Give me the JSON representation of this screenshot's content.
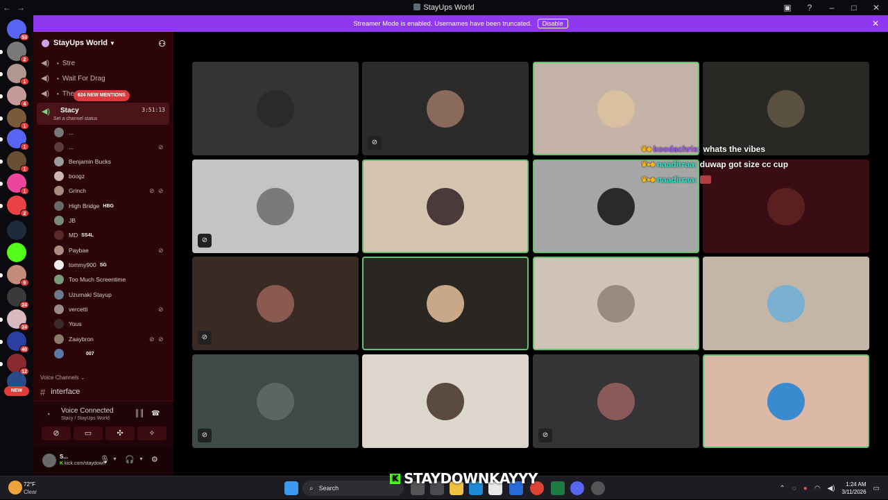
{
  "window": {
    "title": "StayUps World"
  },
  "banner": {
    "text": "Streamer Mode is enabled. Usernames have been truncated.",
    "button": "Disable"
  },
  "guild_badges": [
    "53",
    "2",
    "1",
    "4",
    "1",
    "1",
    "1",
    "1",
    "2",
    "9",
    "24",
    "24",
    "40",
    "12"
  ],
  "guild_new_label": "NEW",
  "server": {
    "name": "StayUps World"
  },
  "mentions_pill": "624 NEW MENTIONS",
  "voice_channels": [
    "Stre",
    "Wait For Drag",
    "The Bridge"
  ],
  "active_channel": {
    "name": "Stacy",
    "timer": "3:51:13",
    "status_prompt": "Set a channel status"
  },
  "members": [
    {
      "name": "...",
      "tag": ""
    },
    {
      "name": "...",
      "tag": ""
    },
    {
      "name": "Benjamin Bucks",
      "tag": ""
    },
    {
      "name": "boogz",
      "tag": ""
    },
    {
      "name": "Grinch",
      "tag": ""
    },
    {
      "name": "High Bridge",
      "tag": "HBG"
    },
    {
      "name": "JB",
      "tag": ""
    },
    {
      "name": "MD",
      "tag": "SS4L"
    },
    {
      "name": "Paybae",
      "tag": ""
    },
    {
      "name": "tommy900",
      "tag": "SG"
    },
    {
      "name": "Too Much Screentime",
      "tag": ""
    },
    {
      "name": "Uzumaki Stayup",
      "tag": ""
    },
    {
      "name": "vercetti",
      "tag": ""
    },
    {
      "name": "Yous",
      "tag": ""
    },
    {
      "name": "Zaaybron",
      "tag": ""
    },
    {
      "name": "",
      "tag": "007"
    }
  ],
  "voice_channels_header": "Voice Channels",
  "text_channel": "interface",
  "voice_panel": {
    "title": "Voice Connected",
    "subtitle": "Stacy / StayUps World"
  },
  "user_panel": {
    "name": "S...",
    "status": "kick.com/staydown"
  },
  "chat": [
    {
      "user": "koodachris:",
      "message": "whats the vibes",
      "color": "#9b59ff"
    },
    {
      "user": "naadirraa:",
      "message": "duwap got size cc cup",
      "color": "#2ee6c8"
    },
    {
      "user": "naadirraa:",
      "message": "",
      "color": "#2ee6c8"
    }
  ],
  "overlay_name": "STAYDOWNKAYYY",
  "taskbar": {
    "temperature": "72°F",
    "condition": "Clear",
    "search": "Search",
    "time": "1:24 AM",
    "date": "3/11/2026"
  }
}
